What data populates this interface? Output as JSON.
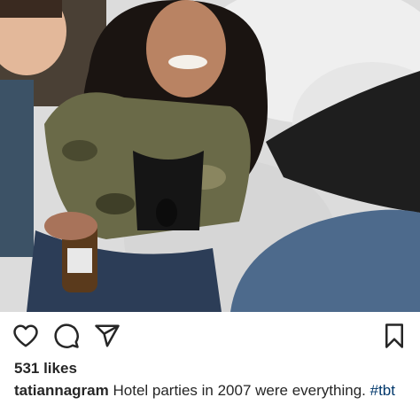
{
  "post": {
    "photo": {
      "alt": ""
    },
    "icons": {
      "like": "heart-icon",
      "comment": "comment-icon",
      "share": "paper-plane-icon",
      "save": "bookmark-icon"
    },
    "likes_text": "531 likes",
    "caption": {
      "username": "tatiannagram",
      "text": "Hotel parties in 2007 were everything.",
      "hashtag": "#tbt"
    }
  },
  "colors": {
    "text": "#262626",
    "hashtag": "#00376b",
    "background": "#ffffff"
  }
}
